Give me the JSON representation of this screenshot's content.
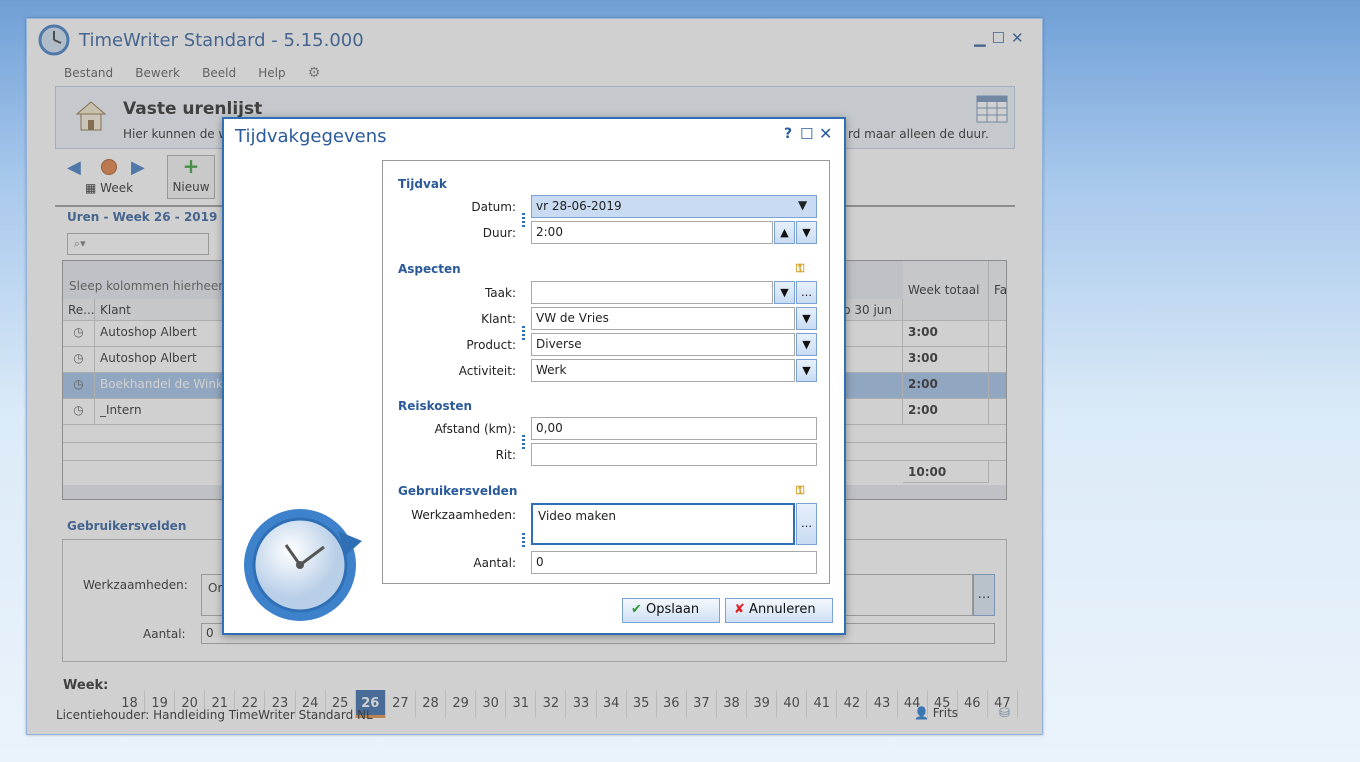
{
  "app": {
    "title": "TimeWriter Standard - 5.15.000",
    "win_controls": {
      "min": "▁",
      "max": "☐",
      "close": "✕"
    }
  },
  "menu": [
    "Bestand",
    "Bewerk",
    "Beeld",
    "Help"
  ],
  "header": {
    "title": "Vaste urenlijst",
    "desc_left": "Hier kunnen de w",
    "desc_right": "rd maar alleen de duur."
  },
  "toolbar": {
    "week_label": "Week",
    "new_label": "Nieuw"
  },
  "grid": {
    "period": "Uren - Week  26 - 2019",
    "group_hint": "Sleep kolommen hierheen",
    "col_re": "Re...",
    "col_klant": "Klant",
    "col_sun": "zo 30 jun",
    "col_total": "Week totaal",
    "col_fa": "Fa",
    "rows": [
      {
        "klant": "Autoshop Albert",
        "total": "3:00"
      },
      {
        "klant": "Autoshop Albert",
        "total": "3:00"
      },
      {
        "klant": "Boekhandel de Winke",
        "total": "2:00"
      },
      {
        "klant": "_Intern",
        "total": "2:00"
      }
    ],
    "grand_total": "10:00"
  },
  "userfields": {
    "title": "Gebruikersvelden",
    "werk_label": "Werkzaamheden:",
    "werk_value": "Or",
    "aantal_label": "Aantal:",
    "aantal_value": "0"
  },
  "weekbar": {
    "label": "Week:",
    "weeks": [
      "18",
      "19",
      "20",
      "21",
      "22",
      "23",
      "24",
      "25",
      "26",
      "27",
      "28",
      "29",
      "30",
      "31",
      "32",
      "33",
      "34",
      "35",
      "36",
      "37",
      "38",
      "39",
      "40",
      "41",
      "42",
      "43",
      "44",
      "45",
      "46",
      "47"
    ],
    "selected": "26"
  },
  "status": {
    "license": "Licentiehouder: Handleiding TimeWriter Standard NL",
    "user": "Frits"
  },
  "dialog": {
    "title": "Tijdvakgegevens",
    "help": "?",
    "max": "☐",
    "close": "✕",
    "sec_tijdvak": "Tijdvak",
    "datum_label": "Datum:",
    "datum_value": "vr 28-06-2019",
    "duur_label": "Duur:",
    "duur_value": "2:00",
    "sec_aspecten": "Aspecten",
    "taak_label": "Taak:",
    "taak_value": "",
    "klant_label": "Klant:",
    "klant_value": "VW de Vries",
    "product_label": "Product:",
    "product_value": "Diverse",
    "activiteit_label": "Activiteit:",
    "activiteit_value": "Werk",
    "sec_reis": "Reiskosten",
    "afstand_label": "Afstand (km):",
    "afstand_value": "0,00",
    "rit_label": "Rit:",
    "rit_value": "",
    "sec_gebr": "Gebruikersvelden",
    "werk_label": "Werkzaamheden:",
    "werk_value": "Video maken",
    "aantal_label": "Aantal:",
    "aantal_value": "0",
    "save": "Opslaan",
    "cancel": "Annuleren"
  },
  "colors": {
    "accent": "#2f6fb6",
    "title": "#2a5a9a",
    "selected_week": "#2f64a8"
  }
}
